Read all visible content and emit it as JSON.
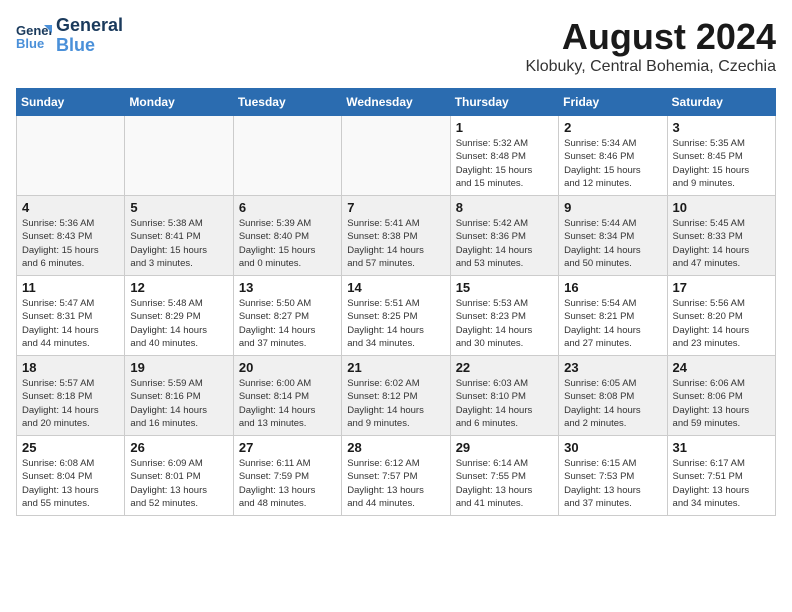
{
  "header": {
    "logo_line1": "General",
    "logo_line2": "Blue",
    "month": "August 2024",
    "location": "Klobuky, Central Bohemia, Czechia"
  },
  "weekdays": [
    "Sunday",
    "Monday",
    "Tuesday",
    "Wednesday",
    "Thursday",
    "Friday",
    "Saturday"
  ],
  "weeks": [
    [
      {
        "day": "",
        "info": ""
      },
      {
        "day": "",
        "info": ""
      },
      {
        "day": "",
        "info": ""
      },
      {
        "day": "",
        "info": ""
      },
      {
        "day": "1",
        "info": "Sunrise: 5:32 AM\nSunset: 8:48 PM\nDaylight: 15 hours\nand 15 minutes."
      },
      {
        "day": "2",
        "info": "Sunrise: 5:34 AM\nSunset: 8:46 PM\nDaylight: 15 hours\nand 12 minutes."
      },
      {
        "day": "3",
        "info": "Sunrise: 5:35 AM\nSunset: 8:45 PM\nDaylight: 15 hours\nand 9 minutes."
      }
    ],
    [
      {
        "day": "4",
        "info": "Sunrise: 5:36 AM\nSunset: 8:43 PM\nDaylight: 15 hours\nand 6 minutes."
      },
      {
        "day": "5",
        "info": "Sunrise: 5:38 AM\nSunset: 8:41 PM\nDaylight: 15 hours\nand 3 minutes."
      },
      {
        "day": "6",
        "info": "Sunrise: 5:39 AM\nSunset: 8:40 PM\nDaylight: 15 hours\nand 0 minutes."
      },
      {
        "day": "7",
        "info": "Sunrise: 5:41 AM\nSunset: 8:38 PM\nDaylight: 14 hours\nand 57 minutes."
      },
      {
        "day": "8",
        "info": "Sunrise: 5:42 AM\nSunset: 8:36 PM\nDaylight: 14 hours\nand 53 minutes."
      },
      {
        "day": "9",
        "info": "Sunrise: 5:44 AM\nSunset: 8:34 PM\nDaylight: 14 hours\nand 50 minutes."
      },
      {
        "day": "10",
        "info": "Sunrise: 5:45 AM\nSunset: 8:33 PM\nDaylight: 14 hours\nand 47 minutes."
      }
    ],
    [
      {
        "day": "11",
        "info": "Sunrise: 5:47 AM\nSunset: 8:31 PM\nDaylight: 14 hours\nand 44 minutes."
      },
      {
        "day": "12",
        "info": "Sunrise: 5:48 AM\nSunset: 8:29 PM\nDaylight: 14 hours\nand 40 minutes."
      },
      {
        "day": "13",
        "info": "Sunrise: 5:50 AM\nSunset: 8:27 PM\nDaylight: 14 hours\nand 37 minutes."
      },
      {
        "day": "14",
        "info": "Sunrise: 5:51 AM\nSunset: 8:25 PM\nDaylight: 14 hours\nand 34 minutes."
      },
      {
        "day": "15",
        "info": "Sunrise: 5:53 AM\nSunset: 8:23 PM\nDaylight: 14 hours\nand 30 minutes."
      },
      {
        "day": "16",
        "info": "Sunrise: 5:54 AM\nSunset: 8:21 PM\nDaylight: 14 hours\nand 27 minutes."
      },
      {
        "day": "17",
        "info": "Sunrise: 5:56 AM\nSunset: 8:20 PM\nDaylight: 14 hours\nand 23 minutes."
      }
    ],
    [
      {
        "day": "18",
        "info": "Sunrise: 5:57 AM\nSunset: 8:18 PM\nDaylight: 14 hours\nand 20 minutes."
      },
      {
        "day": "19",
        "info": "Sunrise: 5:59 AM\nSunset: 8:16 PM\nDaylight: 14 hours\nand 16 minutes."
      },
      {
        "day": "20",
        "info": "Sunrise: 6:00 AM\nSunset: 8:14 PM\nDaylight: 14 hours\nand 13 minutes."
      },
      {
        "day": "21",
        "info": "Sunrise: 6:02 AM\nSunset: 8:12 PM\nDaylight: 14 hours\nand 9 minutes."
      },
      {
        "day": "22",
        "info": "Sunrise: 6:03 AM\nSunset: 8:10 PM\nDaylight: 14 hours\nand 6 minutes."
      },
      {
        "day": "23",
        "info": "Sunrise: 6:05 AM\nSunset: 8:08 PM\nDaylight: 14 hours\nand 2 minutes."
      },
      {
        "day": "24",
        "info": "Sunrise: 6:06 AM\nSunset: 8:06 PM\nDaylight: 13 hours\nand 59 minutes."
      }
    ],
    [
      {
        "day": "25",
        "info": "Sunrise: 6:08 AM\nSunset: 8:04 PM\nDaylight: 13 hours\nand 55 minutes."
      },
      {
        "day": "26",
        "info": "Sunrise: 6:09 AM\nSunset: 8:01 PM\nDaylight: 13 hours\nand 52 minutes."
      },
      {
        "day": "27",
        "info": "Sunrise: 6:11 AM\nSunset: 7:59 PM\nDaylight: 13 hours\nand 48 minutes."
      },
      {
        "day": "28",
        "info": "Sunrise: 6:12 AM\nSunset: 7:57 PM\nDaylight: 13 hours\nand 44 minutes."
      },
      {
        "day": "29",
        "info": "Sunrise: 6:14 AM\nSunset: 7:55 PM\nDaylight: 13 hours\nand 41 minutes."
      },
      {
        "day": "30",
        "info": "Sunrise: 6:15 AM\nSunset: 7:53 PM\nDaylight: 13 hours\nand 37 minutes."
      },
      {
        "day": "31",
        "info": "Sunrise: 6:17 AM\nSunset: 7:51 PM\nDaylight: 13 hours\nand 34 minutes."
      }
    ]
  ]
}
